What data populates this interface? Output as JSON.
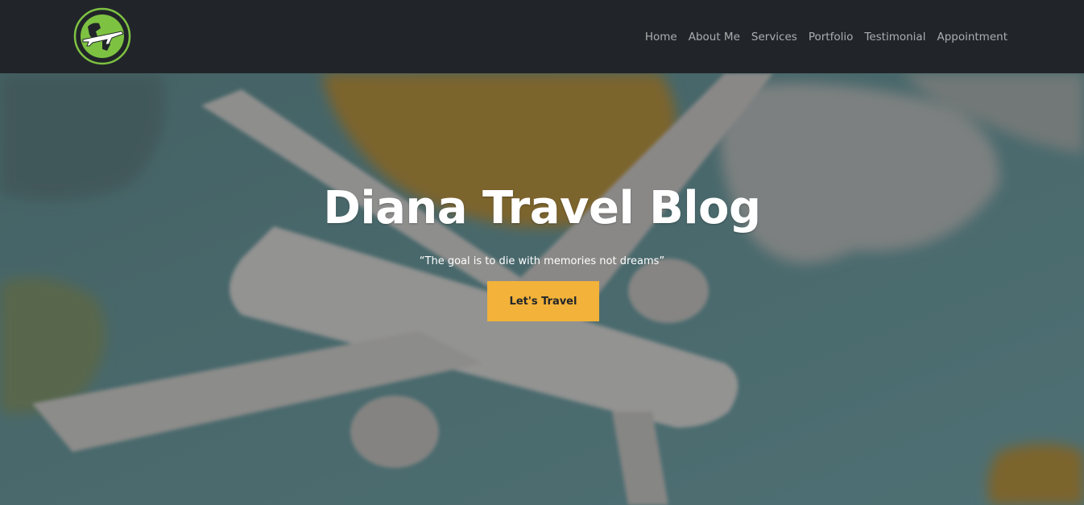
{
  "header": {
    "logo_icon": "globe-airplane-icon",
    "nav": [
      {
        "label": "Home"
      },
      {
        "label": "About Me"
      },
      {
        "label": "Services"
      },
      {
        "label": "Portfolio"
      },
      {
        "label": "Testimonial"
      },
      {
        "label": "Appointment"
      }
    ]
  },
  "hero": {
    "title": "Diana Travel Blog",
    "quote": "“The goal is to die with memories not dreams”",
    "button_label": "Let's Travel",
    "background": "blurred-airplane-on-map-image"
  },
  "colors": {
    "navbar": "#212529",
    "accent": "#f3b23a",
    "logo_green": "#7ec242"
  }
}
